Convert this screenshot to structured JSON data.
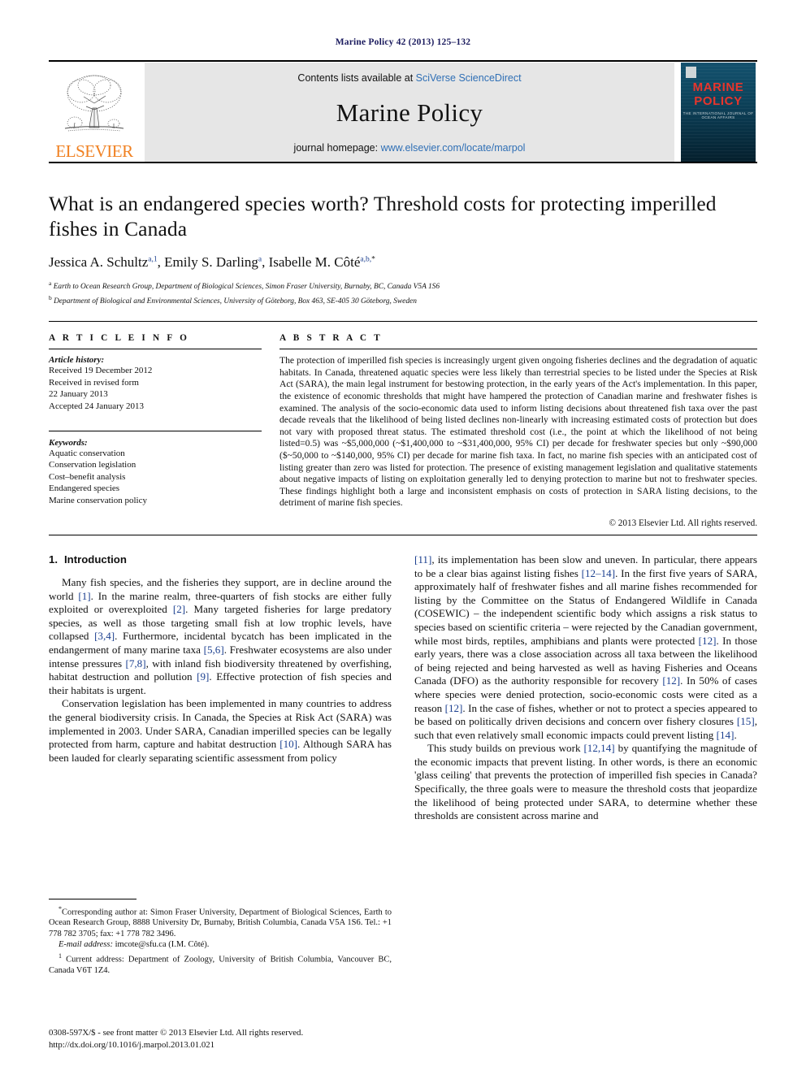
{
  "running_head": "Marine Policy 42 (2013) 125–132",
  "masthead": {
    "publisher_wordmark": "ELSEVIER",
    "contents_prefix": "Contents lists available at ",
    "contents_link": "SciVerse ScienceDirect",
    "journal_name": "Marine Policy",
    "homepage_prefix": "journal homepage: ",
    "homepage_url": "www.elsevier.com/locate/marpol",
    "cover": {
      "title_line1": "MARINE",
      "title_line2": "POLICY",
      "subtitle": "THE INTERNATIONAL JOURNAL OF OCEAN AFFAIRS"
    }
  },
  "article": {
    "title": "What is an endangered species worth? Threshold costs for protecting imperilled fishes in Canada",
    "authors": [
      {
        "name": "Jessica A. Schultz",
        "marks": "a,1",
        "sep": ", "
      },
      {
        "name": "Emily S. Darling",
        "marks": "a",
        "sep": ", "
      },
      {
        "name": "Isabelle M. Côté",
        "marks": "a,b,",
        "star": "*",
        "sep": ""
      }
    ],
    "affiliations": [
      {
        "mark": "a",
        "text": "Earth to Ocean Research Group, Department of Biological Sciences, Simon Fraser University, Burnaby, BC, Canada V5A 1S6"
      },
      {
        "mark": "b",
        "text": "Department of Biological and Environmental Sciences, University of Göteborg, Box 463, SE-405 30 Göteborg, Sweden"
      }
    ]
  },
  "article_info": {
    "heading": "A R T I C L E   I N F O",
    "history_label": "Article history:",
    "history_lines": [
      "Received 19 December 2012",
      "Received in revised form",
      "22 January 2013",
      "Accepted 24 January 2013"
    ],
    "keywords_label": "Keywords:",
    "keywords": [
      "Aquatic conservation",
      "Conservation legislation",
      "Cost–benefit analysis",
      "Endangered species",
      "Marine conservation policy"
    ]
  },
  "abstract": {
    "heading": "A B S T R A C T",
    "text": "The protection of imperilled fish species is increasingly urgent given ongoing fisheries declines and the degradation of aquatic habitats. In Canada, threatened aquatic species were less likely than terrestrial species to be listed under the Species at Risk Act (SARA), the main legal instrument for bestowing protection, in the early years of the Act's implementation. In this paper, the existence of economic thresholds that might have hampered the protection of Canadian marine and freshwater fishes is examined. The analysis of the socio-economic data used to inform listing decisions about threatened fish taxa over the past decade reveals that the likelihood of being listed declines non-linearly with increasing estimated costs of protection but does not vary with proposed threat status. The estimated threshold cost (i.e., the point at which the likelihood of not being listed=0.5) was ~$5,000,000 (~$1,400,000 to ~$31,400,000, 95% CI) per decade for freshwater species but only ~$90,000 ($~50,000 to ~$140,000, 95% CI) per decade for marine fish taxa. In fact, no marine fish species with an anticipated cost of listing greater than zero was listed for protection. The presence of existing management legislation and qualitative statements about negative impacts of listing on exploitation generally led to denying protection to marine but not to freshwater species. These findings highlight both a large and inconsistent emphasis on costs of protection in SARA listing decisions, to the detriment of marine fish species.",
    "copyright": "© 2013 Elsevier Ltd. All rights reserved."
  },
  "introduction": {
    "number": "1.",
    "heading": "Introduction",
    "left_paragraphs": [
      "Many fish species, and the fisheries they support, are in decline around the world [1]. In the marine realm, three-quarters of fish stocks are either fully exploited or overexploited [2]. Many targeted fisheries for large predatory species, as well as those targeting small fish at low trophic levels, have collapsed [3,4]. Furthermore, incidental bycatch has been implicated in the endangerment of many marine taxa [5,6]. Freshwater ecosystems are also under intense pressures [7,8], with inland fish biodiversity threatened by overfishing, habitat destruction and pollution [9]. Effective protection of fish species and their habitats is urgent.",
      "Conservation legislation has been implemented in many countries to address the general biodiversity crisis. In Canada, the Species at Risk Act (SARA) was implemented in 2003. Under SARA, Canadian imperilled species can be legally protected from harm, capture and habitat destruction [10]. Although SARA has been lauded for clearly separating scientific assessment from policy"
    ],
    "right_paragraphs": [
      "[11], its implementation has been slow and uneven. In particular, there appears to be a clear bias against listing fishes [12–14]. In the first five years of SARA, approximately half of freshwater fishes and all marine fishes recommended for listing by the Committee on the Status of Endangered Wildlife in Canada (COSEWIC) – the independent scientific body which assigns a risk status to species based on scientific criteria – were rejected by the Canadian government, while most birds, reptiles, amphibians and plants were protected [12]. In those early years, there was a close association across all taxa between the likelihood of being rejected and being harvested as well as having Fisheries and Oceans Canada (DFO) as the authority responsible for recovery [12]. In 50% of cases where species were denied protection, socio-economic costs were cited as a reason [12]. In the case of fishes, whether or not to protect a species appeared to be based on politically driven decisions and concern over fishery closures [15], such that even relatively small economic impacts could prevent listing [14].",
      "This study builds on previous work [12,14] by quantifying the magnitude of the economic impacts that prevent listing. In other words, is there an economic 'glass ceiling' that prevents the protection of imperilled fish species in Canada? Specifically, the three goals were to measure the threshold costs that jeopardize the likelihood of being protected under SARA, to determine whether these thresholds are consistent across marine and"
    ]
  },
  "footnotes": {
    "corresponding_mark": "*",
    "corresponding": "Corresponding author at: Simon Fraser University, Department of Biological Sciences, Earth to Ocean Research Group, 8888 University Dr, Burnaby, British Columbia, Canada V5A 1S6. Tel.: +1 778 782 3705; fax: +1 778 782 3496.",
    "email_label": "E-mail address:",
    "email_value": "imcote@sfu.ca (I.M. Côté).",
    "current_address_mark": "1",
    "current_address": "Current address: Department of Zoology, University of British Columbia, Vancouver BC, Canada V6T 1Z4."
  },
  "bottom_matter": {
    "issn_line": "0308-597X/$ - see front matter © 2013 Elsevier Ltd. All rights reserved.",
    "doi_line": "http://dx.doi.org/10.1016/j.marpol.2013.01.021"
  },
  "colors": {
    "link_blue": "#2f6fb5",
    "reference_blue": "#1b3f8f",
    "elsevier_orange": "#f08122",
    "running_head_navy": "#1b1b5e",
    "cover_red": "#e8352c",
    "band_grey": "#e6e6e6"
  }
}
